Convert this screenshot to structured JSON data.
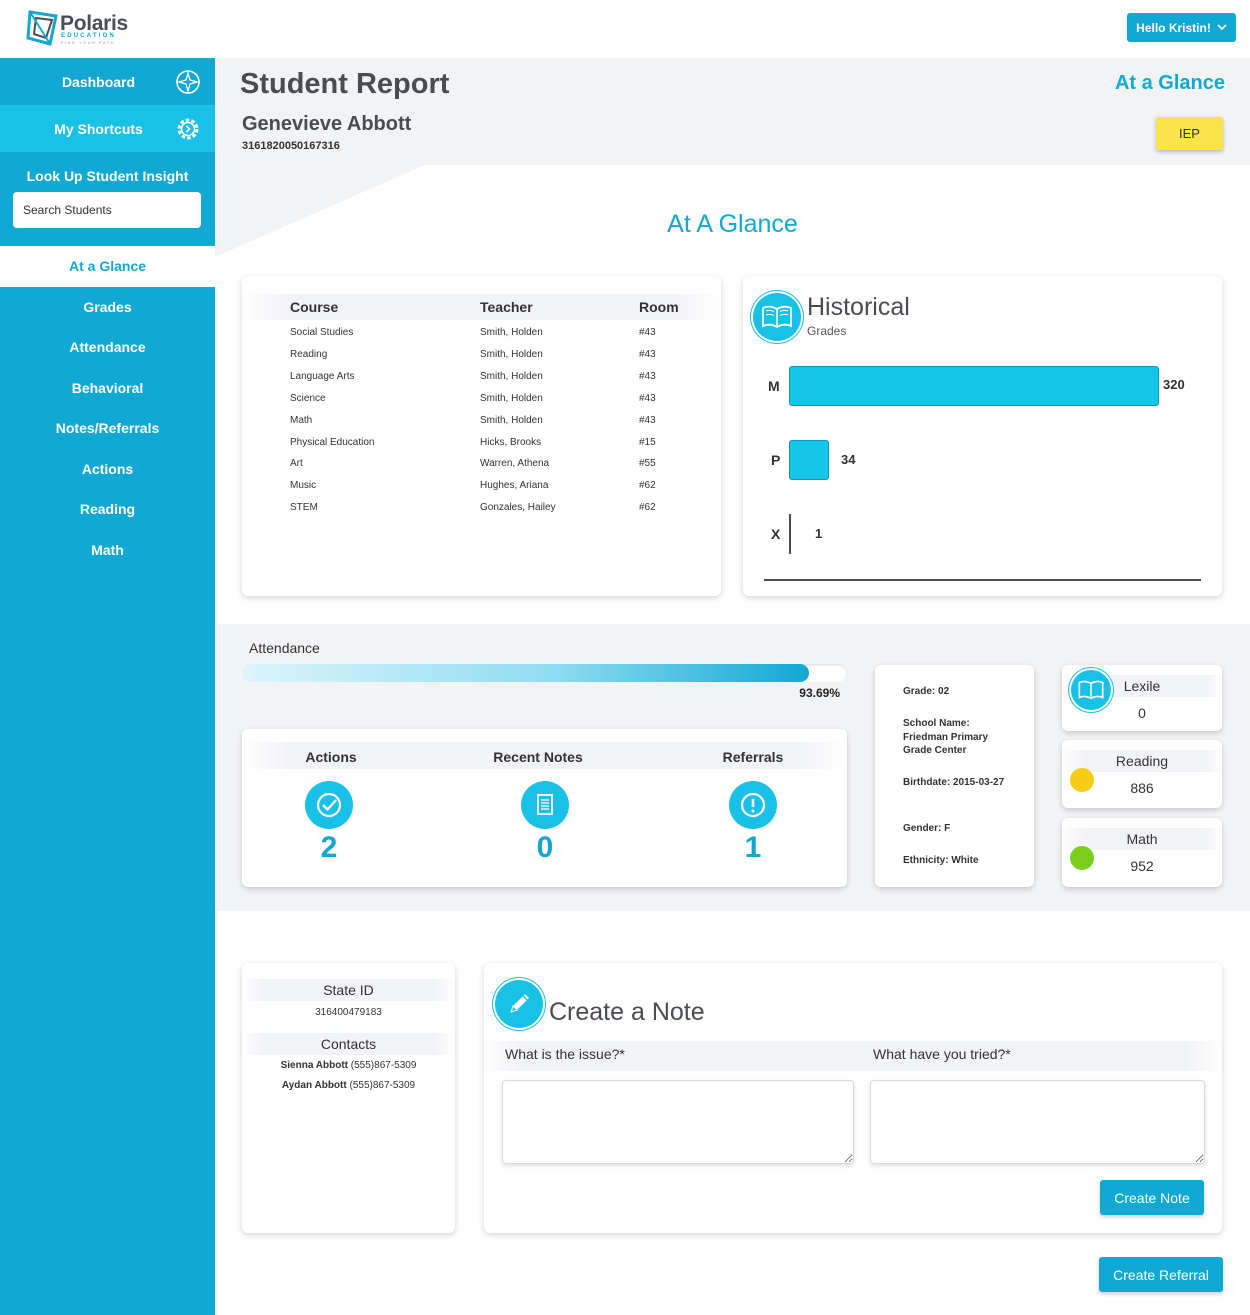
{
  "brand": {
    "name": "Polaris",
    "subtitle": "EDUCATION",
    "tagline": "FIND YOUR PATH"
  },
  "user_menu": {
    "label": "Hello Kristin!",
    "icon": "chevron-down-icon"
  },
  "sidebar": {
    "dashboard_label": "Dashboard",
    "dashboard_icon": "compass-icon",
    "shortcuts_label": "My Shortcuts",
    "shortcuts_icon": "gear-icon",
    "lookup_title": "Look Up Student Insight",
    "search_placeholder": "Search Students",
    "nav": [
      "At a Glance",
      "Grades",
      "Attendance",
      "Behavioral",
      "Notes/Referrals",
      "Actions",
      "Reading",
      "Math"
    ],
    "active_index": 0
  },
  "header": {
    "page_title": "Student Report",
    "student_name": "Genevieve Abbott",
    "student_id": "3161820050167316",
    "section_link": "At a Glance",
    "iep_label": "IEP"
  },
  "section_title": "At A Glance",
  "courses": {
    "columns": [
      "Course",
      "Teacher",
      "Room"
    ],
    "rows": [
      [
        "Social Studies",
        "Smith, Holden",
        "#43"
      ],
      [
        "Reading",
        "Smith, Holden",
        "#43"
      ],
      [
        "Language Arts",
        "Smith, Holden",
        "#43"
      ],
      [
        "Science",
        "Smith, Holden",
        "#43"
      ],
      [
        "Math",
        "Smith, Holden",
        "#43"
      ],
      [
        "Physical Education",
        "Hicks, Brooks",
        "#15"
      ],
      [
        "Art",
        "Warren, Athena",
        "#55"
      ],
      [
        "Music",
        "Hughes, Ariana",
        "#62"
      ],
      [
        "STEM",
        "Gonzales, Hailey",
        "#62"
      ]
    ]
  },
  "historical": {
    "title": "Historical",
    "subtitle": "Grades",
    "icon": "book-icon",
    "bar_color": "#15c5ea"
  },
  "chart_data": {
    "type": "bar",
    "orientation": "horizontal",
    "title": "Historical",
    "subtitle": "Grades",
    "categories": [
      "M",
      "P",
      "X"
    ],
    "values": [
      320,
      34,
      1
    ],
    "xlim": [
      0,
      320
    ]
  },
  "attendance": {
    "label": "Attendance",
    "percent_text": "93.69%",
    "fraction": 0.9369
  },
  "summary": {
    "items": [
      {
        "label": "Actions",
        "value": "2",
        "icon": "check-circle-icon"
      },
      {
        "label": "Recent Notes",
        "value": "0",
        "icon": "document-icon"
      },
      {
        "label": "Referrals",
        "value": "1",
        "icon": "alert-icon"
      }
    ],
    "accent": "#12a8d4"
  },
  "student_info": {
    "grade": "Grade: 02",
    "school": "School Name: Friedman Primary Grade Center",
    "birthdate": "Birthdate: 2015-03-27",
    "gender": "Gender: F",
    "ethnicity": "Ethnicity: White"
  },
  "scores": {
    "lexile": {
      "label": "Lexile",
      "value": "0",
      "icon": "book-icon"
    },
    "reading": {
      "label": "Reading",
      "value": "886",
      "dot_color": "#f6cc16"
    },
    "math": {
      "label": "Math",
      "value": "952",
      "dot_color": "#7ccf1c"
    }
  },
  "state": {
    "title": "State ID",
    "value": "316400479183",
    "contacts_title": "Contacts",
    "contacts": [
      {
        "name": "Sienna Abbott",
        "phone": "(555)867-5309"
      },
      {
        "name": "Aydan Abbott",
        "phone": "(555)867-5309"
      }
    ]
  },
  "note": {
    "title": "Create a Note",
    "icon": "pencil-icon",
    "question_issue": "What is the issue?*",
    "question_tried": "What have you tried?*",
    "create_note_label": "Create Note",
    "create_referral_label": "Create Referral"
  }
}
